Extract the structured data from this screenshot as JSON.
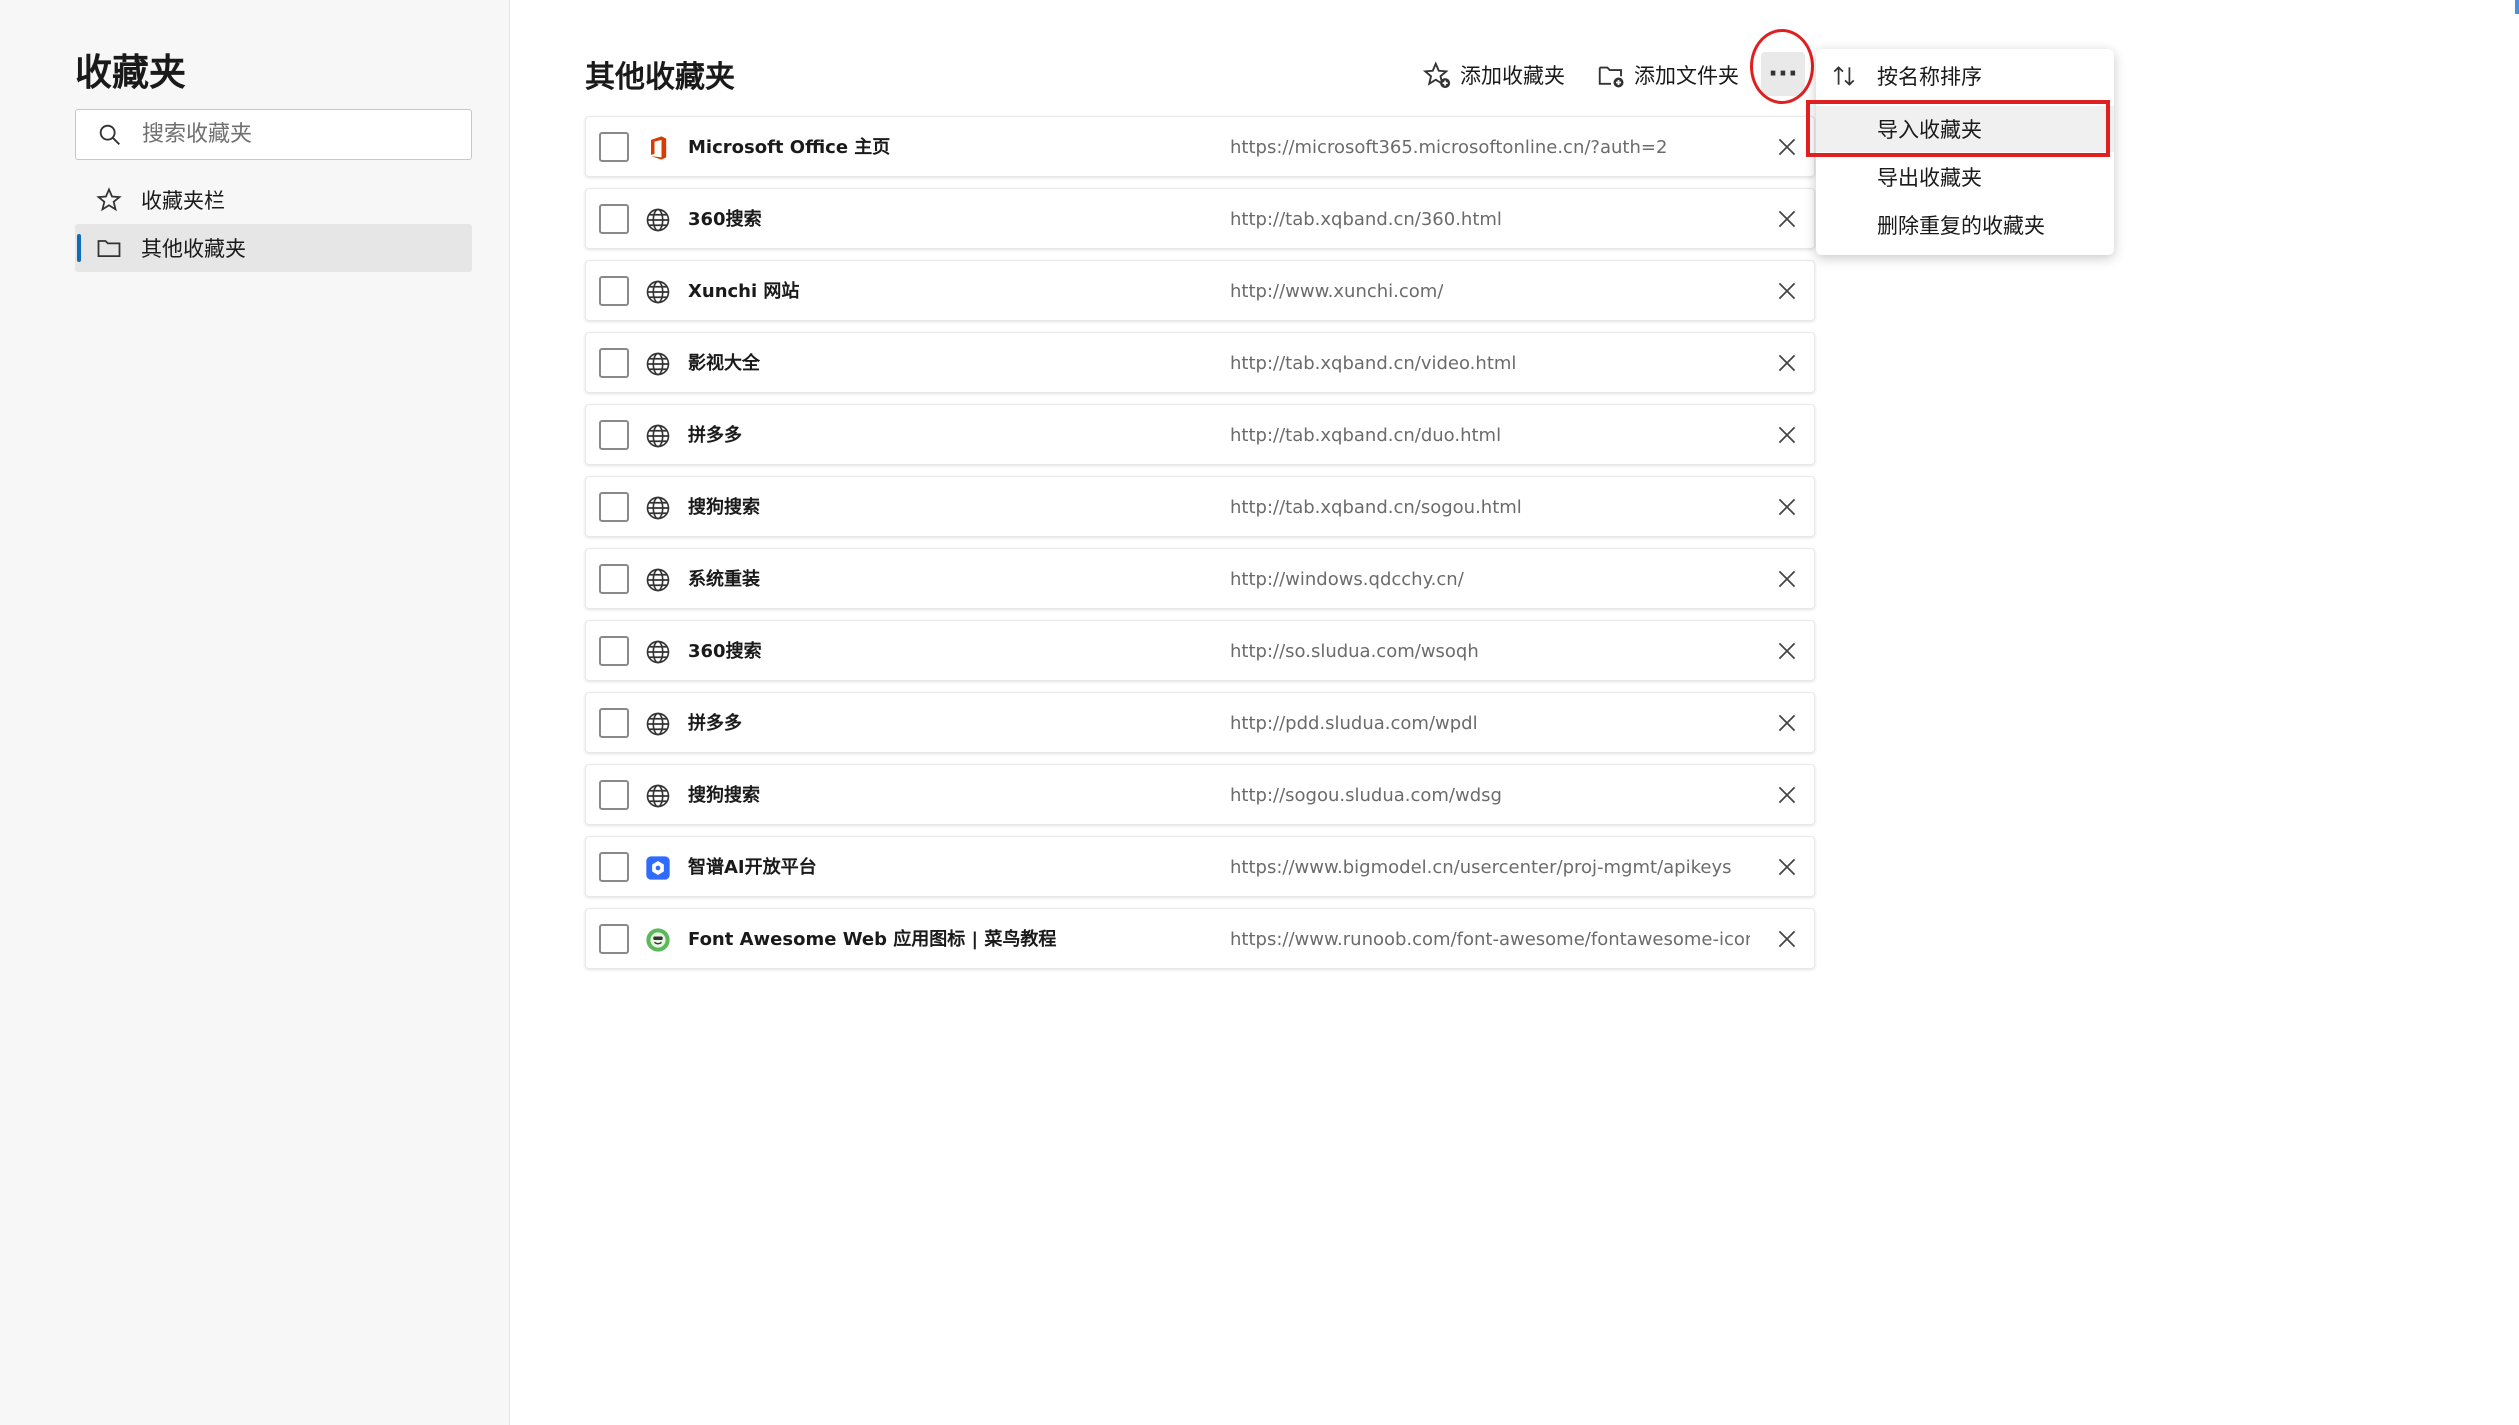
{
  "sidebar": {
    "title": "收藏夹",
    "search_placeholder": "搜索收藏夹",
    "items": [
      {
        "label": "收藏夹栏",
        "icon": "star-icon"
      },
      {
        "label": "其他收藏夹",
        "icon": "folder-icon",
        "active": true
      }
    ]
  },
  "main": {
    "title": "其他收藏夹",
    "add_favorite_label": "添加收藏夹",
    "add_folder_label": "添加文件夹",
    "more_label": "···"
  },
  "bookmarks": [
    {
      "title": "Microsoft Office 主页",
      "url": "https://microsoft365.microsoftonline.cn/?auth=2",
      "icon": "office-icon"
    },
    {
      "title": "360搜索",
      "url": "http://tab.xqband.cn/360.html",
      "icon": "globe-icon"
    },
    {
      "title": "Xunchi 网站",
      "url": "http://www.xunchi.com/",
      "icon": "globe-icon"
    },
    {
      "title": "影视大全",
      "url": "http://tab.xqband.cn/video.html",
      "icon": "globe-icon"
    },
    {
      "title": "拼多多",
      "url": "http://tab.xqband.cn/duo.html",
      "icon": "globe-icon"
    },
    {
      "title": "搜狗搜索",
      "url": "http://tab.xqband.cn/sogou.html",
      "icon": "globe-icon"
    },
    {
      "title": "系统重装",
      "url": "http://windows.qdcchy.cn/",
      "icon": "globe-icon"
    },
    {
      "title": "360搜索",
      "url": "http://so.sludua.com/wsoqh",
      "icon": "globe-icon"
    },
    {
      "title": "拼多多",
      "url": "http://pdd.sludua.com/wpdl",
      "icon": "globe-icon"
    },
    {
      "title": "搜狗搜索",
      "url": "http://sogou.sludua.com/wdsg",
      "icon": "globe-icon"
    },
    {
      "title": "智谱AI开放平台",
      "url": "https://www.bigmodel.cn/usercenter/proj-mgmt/apikeys",
      "icon": "zhipu-icon"
    },
    {
      "title": "Font Awesome Web 应用图标 | 菜鸟教程",
      "url": "https://www.runoob.com/font-awesome/fontawesome-icons-w...",
      "icon": "runoob-icon"
    }
  ],
  "menu": {
    "items": [
      {
        "label": "按名称排序",
        "icon": "sort-icon"
      },
      {
        "label": "导入收藏夹"
      },
      {
        "label": "导出收藏夹"
      },
      {
        "label": "删除重复的收藏夹"
      }
    ]
  },
  "colors": {
    "accent": "#0f6cbd",
    "highlight": "#e02020",
    "office": "#d83b01",
    "zhipu": "#2f6bff",
    "runoob": "#5cb85c"
  }
}
